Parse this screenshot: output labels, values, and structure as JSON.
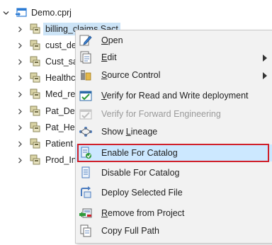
{
  "tree": {
    "root": {
      "label": "Demo.cprj"
    },
    "items": [
      {
        "label": "billing_claims.Sact"
      },
      {
        "label": "cust_de"
      },
      {
        "label": "Cust_sa"
      },
      {
        "label": "Healthc"
      },
      {
        "label": "Med_re"
      },
      {
        "label": "Pat_Det"
      },
      {
        "label": "Pat_He"
      },
      {
        "label": "Patient"
      },
      {
        "label": "Prod_In"
      }
    ]
  },
  "context_menu": {
    "items": [
      {
        "label": "Open",
        "underline": "O",
        "rest": "pen",
        "icon": "edit-pencil-icon",
        "enabled": true
      },
      {
        "label": "Edit",
        "underline": "E",
        "rest": "dit",
        "icon": "document-icon",
        "submenu": true,
        "enabled": true
      },
      {
        "label": "Source Control",
        "underline": "S",
        "rest": "ource Control",
        "icon": "source-control-icon",
        "submenu": true,
        "enabled": true
      },
      {
        "label": "Verify for Read and Write deployment",
        "underline": "V",
        "rest": "erify for Read and Write deployment",
        "icon": "verify-check-icon",
        "enabled": true
      },
      {
        "label": "Verify for Forward Engineering",
        "icon": "verify-check-disabled-icon",
        "enabled": false
      },
      {
        "label": "Show Lineage",
        "prefix": "Show ",
        "underline": "L",
        "rest": "ineage",
        "icon": "lineage-icon",
        "enabled": true
      },
      {
        "label": "Enable For Catalog",
        "icon": "catalog-enable-icon",
        "enabled": true,
        "highlighted": true
      },
      {
        "label": "Disable For Catalog",
        "icon": "catalog-disable-icon",
        "enabled": true
      },
      {
        "label": "Deploy Selected File",
        "icon": "deploy-icon",
        "enabled": true
      },
      {
        "label": "Remove from Project",
        "underline": "R",
        "rest": "emove from Project",
        "icon": "remove-icon",
        "enabled": true
      },
      {
        "label": "Copy Full Path",
        "icon": "copy-icon",
        "enabled": true
      }
    ]
  },
  "colors": {
    "highlight_border": "#d0202a",
    "highlight_fill": "#cce8ff",
    "tree_selection": "#cce4f7",
    "menu_bg": "#f2f2f2"
  }
}
